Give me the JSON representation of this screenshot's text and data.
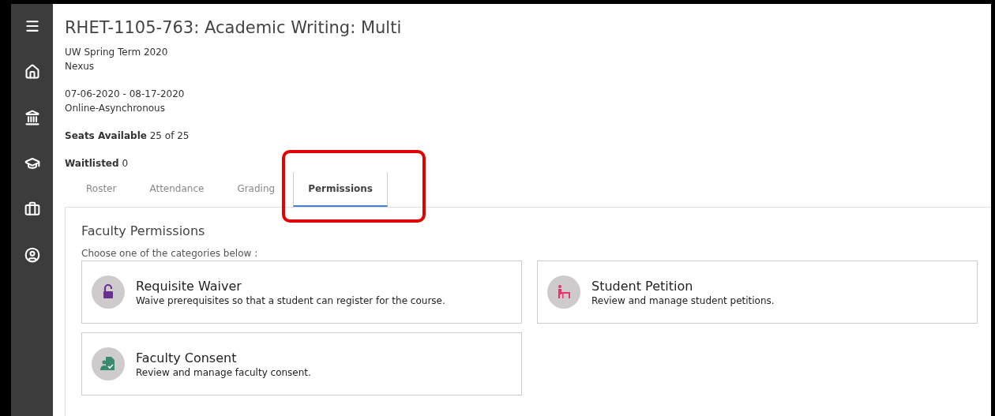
{
  "sidebar": {
    "items": [
      {
        "kind": "menu"
      },
      {
        "kind": "home"
      },
      {
        "kind": "bank"
      },
      {
        "kind": "cap"
      },
      {
        "kind": "briefcase"
      },
      {
        "kind": "user"
      }
    ]
  },
  "course": {
    "title": "RHET-1105-763: Academic Writing: Multi",
    "term": "UW Spring Term 2020",
    "campus": "Nexus",
    "dates": "07-06-2020 - 08-17-2020",
    "mode": "Online-Asynchronous",
    "seats_label": "Seats Available",
    "seats_value": "25 of 25",
    "waitlist_label": "Waitlisted",
    "waitlist_value": "0"
  },
  "tabs": [
    {
      "label": "Roster",
      "selected": false
    },
    {
      "label": "Attendance",
      "selected": false
    },
    {
      "label": "Grading",
      "selected": false
    },
    {
      "label": "Permissions",
      "selected": true,
      "highlighted": true
    }
  ],
  "panel": {
    "title": "Faculty Permissions",
    "instruction": "Choose one of the categories below :",
    "cards": [
      {
        "kind": "waiver",
        "color": "#6a2e91",
        "title": "Requisite Waiver",
        "description": "Waive prerequisites so that a student can register for the course."
      },
      {
        "kind": "petition",
        "color": "#e8336d",
        "title": "Student Petition",
        "description": "Review and manage student petitions."
      },
      {
        "kind": "consent",
        "color": "#3a8a6e",
        "title": "Faculty Consent",
        "description": "Review and manage faculty consent."
      }
    ]
  }
}
